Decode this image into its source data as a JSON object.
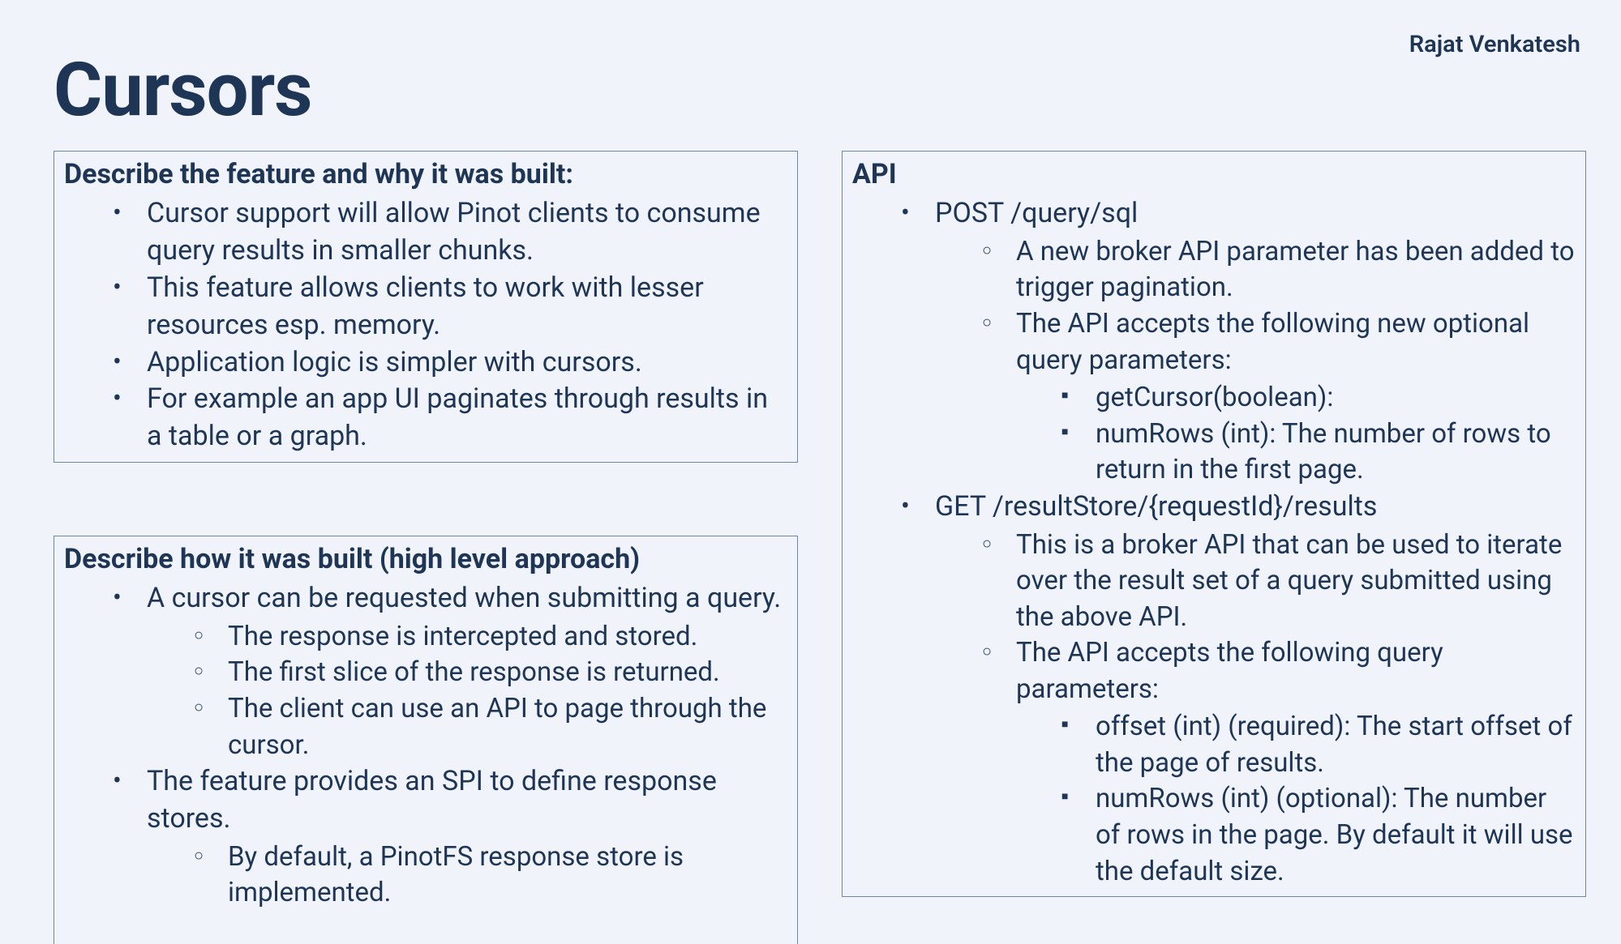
{
  "author": "Rajat Venkatesh",
  "title": "Cursors",
  "box1": {
    "heading": "Describe the feature and why it was built:",
    "items": [
      "Cursor support will allow Pinot clients to consume query results in smaller chunks.",
      " This feature allows clients to work with lesser resources esp. memory.",
      "Application logic is simpler with cursors.",
      "For example an app UI paginates through results in a table or a graph."
    ]
  },
  "box2": {
    "heading": "Describe how it was built (high level approach)",
    "items": [
      {
        "text": "A cursor can be requested when submitting a query.",
        "sub": [
          "The response is intercepted and stored.",
          "The first slice of the response is returned.",
          "The client can use an API to page through the cursor."
        ]
      },
      {
        "text": "The feature provides an SPI to define response stores.",
        "sub": [
          "By default, a PinotFS response store is implemented."
        ]
      }
    ]
  },
  "box3": {
    "heading": "API",
    "items": [
      {
        "text": "POST /query/sql",
        "sub": [
          {
            "text": "A new broker API parameter has been added to trigger pagination."
          },
          {
            "text": "The API accepts the following new optional query parameters:",
            "sub": [
              "getCursor(boolean):",
              "numRows (int): The number of rows to return in the first page."
            ]
          }
        ]
      },
      {
        "text": "GET /resultStore/{requestId}/results",
        "sub": [
          {
            "text": "This is a broker API that can be used to iterate over the result set of a query submitted using the above API."
          },
          {
            "text": "The API accepts the following query parameters:",
            "sub": [
              "offset (int) (required): The start offset of the page of results.",
              "numRows (int) (optional): The number of rows in the page. By default it will use the default size."
            ]
          }
        ]
      }
    ]
  }
}
